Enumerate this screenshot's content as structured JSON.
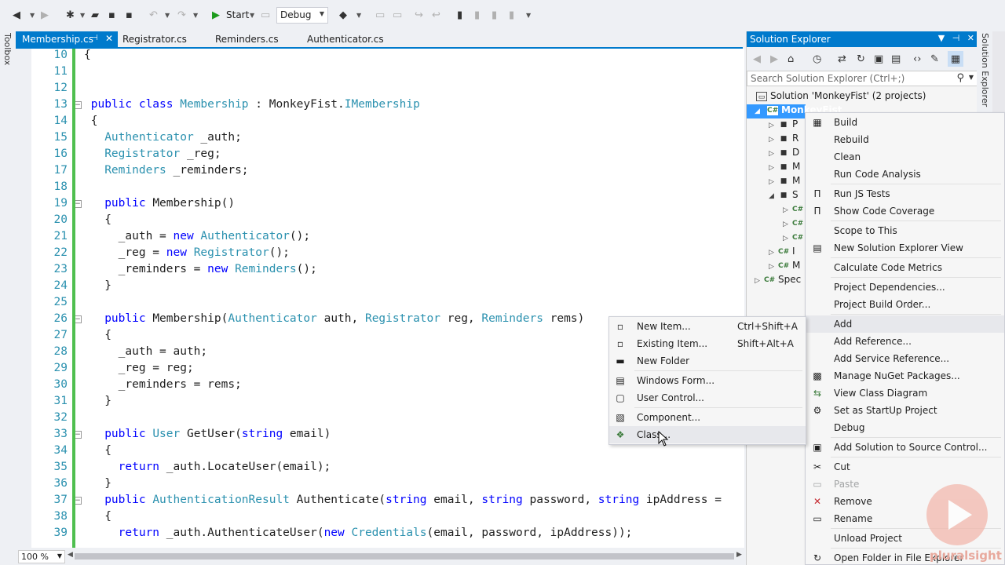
{
  "toolbar": {
    "start_label": "Start",
    "config_value": "Debug"
  },
  "side": {
    "toolbox_label": "Toolbox",
    "solution_explorer_label": "Solution Explorer"
  },
  "tabs": [
    {
      "label": "Membership.cs"
    },
    {
      "label": "Registrator.cs"
    },
    {
      "label": "Reminders.cs"
    },
    {
      "label": "Authenticator.cs"
    }
  ],
  "editor": {
    "lines": [
      {
        "n": "10",
        "parts": [
          [
            "p",
            "{"
          ]
        ]
      },
      {
        "n": "11",
        "parts": []
      },
      {
        "n": "12",
        "parts": []
      },
      {
        "n": "13",
        "fold": true,
        "parts": [
          [
            "p",
            " "
          ],
          [
            "k",
            "public class "
          ],
          [
            "t",
            "Membership"
          ],
          [
            "p",
            " : MonkeyFist."
          ],
          [
            "t",
            "IMembership"
          ]
        ]
      },
      {
        "n": "14",
        "parts": [
          [
            "p",
            " {"
          ]
        ]
      },
      {
        "n": "15",
        "parts": [
          [
            "p",
            "   "
          ],
          [
            "t",
            "Authenticator"
          ],
          [
            "p",
            " _auth;"
          ]
        ]
      },
      {
        "n": "16",
        "parts": [
          [
            "p",
            "   "
          ],
          [
            "t",
            "Registrator"
          ],
          [
            "p",
            " _reg;"
          ]
        ]
      },
      {
        "n": "17",
        "parts": [
          [
            "p",
            "   "
          ],
          [
            "t",
            "Reminders"
          ],
          [
            "p",
            " _reminders;"
          ]
        ]
      },
      {
        "n": "18",
        "parts": []
      },
      {
        "n": "19",
        "fold": true,
        "parts": [
          [
            "p",
            "   "
          ],
          [
            "k",
            "public"
          ],
          [
            "p",
            " Membership()"
          ]
        ]
      },
      {
        "n": "20",
        "parts": [
          [
            "p",
            "   {"
          ]
        ]
      },
      {
        "n": "21",
        "parts": [
          [
            "p",
            "     _auth = "
          ],
          [
            "k",
            "new "
          ],
          [
            "t",
            "Authenticator"
          ],
          [
            "p",
            "();"
          ]
        ]
      },
      {
        "n": "22",
        "parts": [
          [
            "p",
            "     _reg = "
          ],
          [
            "k",
            "new "
          ],
          [
            "t",
            "Registrator"
          ],
          [
            "p",
            "();"
          ]
        ]
      },
      {
        "n": "23",
        "parts": [
          [
            "p",
            "     _reminders = "
          ],
          [
            "k",
            "new "
          ],
          [
            "t",
            "Reminders"
          ],
          [
            "p",
            "();"
          ]
        ]
      },
      {
        "n": "24",
        "parts": [
          [
            "p",
            "   }"
          ]
        ]
      },
      {
        "n": "25",
        "parts": []
      },
      {
        "n": "26",
        "fold": true,
        "parts": [
          [
            "p",
            "   "
          ],
          [
            "k",
            "public"
          ],
          [
            "p",
            " Membership("
          ],
          [
            "t",
            "Authenticator"
          ],
          [
            "p",
            " auth, "
          ],
          [
            "t",
            "Registrator"
          ],
          [
            "p",
            " reg, "
          ],
          [
            "t",
            "Reminders"
          ],
          [
            "p",
            " rems)"
          ]
        ]
      },
      {
        "n": "27",
        "parts": [
          [
            "p",
            "   {"
          ]
        ]
      },
      {
        "n": "28",
        "parts": [
          [
            "p",
            "     _auth = auth;"
          ]
        ]
      },
      {
        "n": "29",
        "parts": [
          [
            "p",
            "     _reg = reg;"
          ]
        ]
      },
      {
        "n": "30",
        "parts": [
          [
            "p",
            "     _reminders = rems;"
          ]
        ]
      },
      {
        "n": "31",
        "parts": [
          [
            "p",
            "   }"
          ]
        ]
      },
      {
        "n": "32",
        "parts": []
      },
      {
        "n": "33",
        "fold": true,
        "parts": [
          [
            "p",
            "   "
          ],
          [
            "k",
            "public "
          ],
          [
            "t",
            "User"
          ],
          [
            "p",
            " GetUser("
          ],
          [
            "k",
            "string"
          ],
          [
            "p",
            " email)"
          ]
        ]
      },
      {
        "n": "34",
        "parts": [
          [
            "p",
            "   {"
          ]
        ]
      },
      {
        "n": "35",
        "parts": [
          [
            "p",
            "     "
          ],
          [
            "k",
            "return"
          ],
          [
            "p",
            " _auth.LocateUser(email);"
          ]
        ]
      },
      {
        "n": "36",
        "parts": [
          [
            "p",
            "   }"
          ]
        ]
      },
      {
        "n": "37",
        "fold": true,
        "parts": [
          [
            "p",
            "   "
          ],
          [
            "k",
            "public "
          ],
          [
            "t",
            "AuthenticationResult"
          ],
          [
            "p",
            " Authenticate("
          ],
          [
            "k",
            "string"
          ],
          [
            "p",
            " email, "
          ],
          [
            "k",
            "string"
          ],
          [
            "p",
            " password, "
          ],
          [
            "k",
            "string"
          ],
          [
            "p",
            " ipAddress ="
          ]
        ]
      },
      {
        "n": "38",
        "parts": [
          [
            "p",
            "   {"
          ]
        ]
      },
      {
        "n": "39",
        "parts": [
          [
            "p",
            "     "
          ],
          [
            "k",
            "return"
          ],
          [
            "p",
            " _auth.AuthenticateUser("
          ],
          [
            "k",
            "new "
          ],
          [
            "t",
            "Credentials"
          ],
          [
            "p",
            "(email, password, ipAddress));"
          ]
        ]
      }
    ]
  },
  "status": {
    "zoom": "100 %"
  },
  "solution_explorer": {
    "title": "Solution Explorer",
    "search_placeholder": "Search Solution Explorer (Ctrl+;)",
    "solution": "Solution 'MonkeyFist' (2 projects)",
    "project": "MonkeyFist",
    "children": [
      {
        "t": "P",
        "icon": "P"
      },
      {
        "t": "R",
        "icon": "R"
      },
      {
        "t": "D",
        "icon": "D"
      },
      {
        "t": "M",
        "icon": "M"
      },
      {
        "t": "M",
        "icon": "M"
      },
      {
        "t": "S",
        "icon": "S"
      },
      {
        "t": "",
        "icon": "c#"
      },
      {
        "t": "",
        "icon": "c#"
      },
      {
        "t": "",
        "icon": "c#"
      },
      {
        "t": "I",
        "icon": "c#"
      },
      {
        "t": "M",
        "icon": "c#"
      }
    ],
    "spec": "Spec"
  },
  "context_menu": {
    "items": [
      {
        "label": "Build",
        "icon": "build-icon",
        "glyph": "▦"
      },
      {
        "label": "Rebuild"
      },
      {
        "label": "Clean"
      },
      {
        "label": "Run Code Analysis"
      },
      {
        "sep": true
      },
      {
        "label": "Run JS Tests",
        "icon": "test-icon",
        "glyph": "Π"
      },
      {
        "label": "Show Code Coverage",
        "icon": "coverage-icon",
        "glyph": "Π"
      },
      {
        "sep": true
      },
      {
        "label": "Scope to This"
      },
      {
        "label": "New Solution Explorer View",
        "icon": "new-view-icon",
        "glyph": "▤"
      },
      {
        "sep": true
      },
      {
        "label": "Calculate Code Metrics"
      },
      {
        "sep": true
      },
      {
        "label": "Project Dependencies..."
      },
      {
        "label": "Project Build Order..."
      },
      {
        "sep": true
      },
      {
        "label": "Add",
        "hl": true
      },
      {
        "label": "Add Reference..."
      },
      {
        "label": "Add Service Reference..."
      },
      {
        "label": "Manage NuGet Packages...",
        "icon": "nuget-icon",
        "glyph": "▩"
      },
      {
        "label": "View Class Diagram",
        "icon": "class-diagram-icon",
        "glyph": "⇆"
      },
      {
        "label": "Set as StartUp Project",
        "icon": "gear-icon",
        "glyph": "⚙"
      },
      {
        "label": "Debug"
      },
      {
        "sep": true
      },
      {
        "label": "Add Solution to Source Control...",
        "icon": "source-control-icon",
        "glyph": "▣"
      },
      {
        "sep": true
      },
      {
        "label": "Cut",
        "icon": "cut-icon",
        "glyph": "✂"
      },
      {
        "label": "Paste",
        "dis": true,
        "icon": "paste-icon",
        "glyph": "▭"
      },
      {
        "label": "Remove",
        "icon": "remove-icon",
        "glyph": "✕"
      },
      {
        "label": "Rename",
        "icon": "rename-icon",
        "glyph": "▭"
      },
      {
        "sep": true
      },
      {
        "label": "Unload Project"
      },
      {
        "sep": true
      },
      {
        "label": "Open Folder in File Explorer",
        "icon": "folder-icon",
        "glyph": "↻"
      }
    ]
  },
  "submenu": {
    "items": [
      {
        "label": "New Item...",
        "shortcut": "Ctrl+Shift+A",
        "icon": "new-item-icon",
        "glyph": "▫"
      },
      {
        "label": "Existing Item...",
        "shortcut": "Shift+Alt+A",
        "icon": "existing-item-icon",
        "glyph": "▫"
      },
      {
        "label": "New Folder",
        "icon": "new-folder-icon",
        "glyph": "▬"
      },
      {
        "sep": true
      },
      {
        "label": "Windows Form...",
        "icon": "windows-form-icon",
        "glyph": "▤"
      },
      {
        "label": "User Control...",
        "icon": "user-control-icon",
        "glyph": "▢"
      },
      {
        "sep": true
      },
      {
        "label": "Component...",
        "icon": "component-icon",
        "glyph": "▧"
      },
      {
        "label": "Class...",
        "icon": "class-icon",
        "glyph": "❖",
        "hl": true
      }
    ]
  },
  "watermark": {
    "text": "pluralsight"
  },
  "colors": {
    "accent": "#007acc",
    "selection": "#3399ff",
    "keyword": "#0000ff",
    "type": "#2b91af",
    "line_number": "#2b91af",
    "changed_margin": "#4fbf4f"
  }
}
